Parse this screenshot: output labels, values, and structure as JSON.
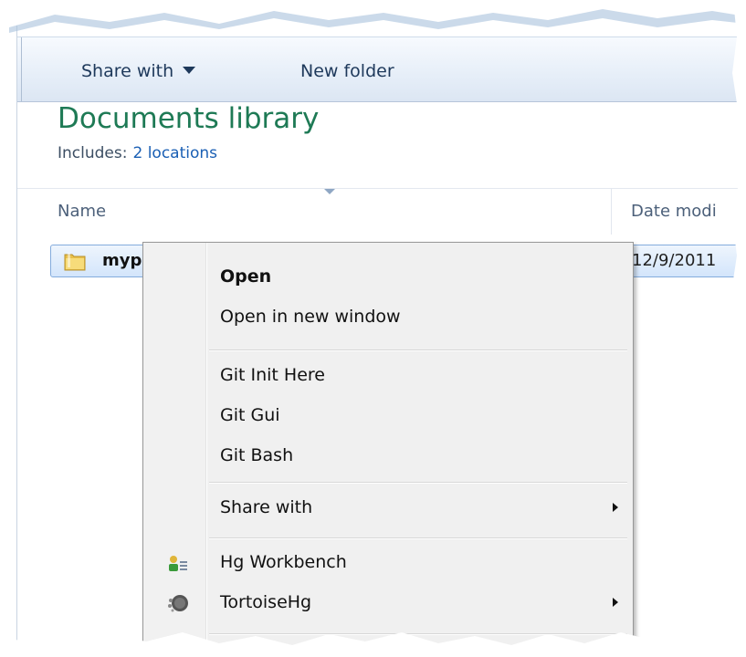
{
  "toolbar": {
    "share_with_label": "Share with",
    "new_folder_label": "New folder"
  },
  "library": {
    "title": "Documents library",
    "includes_label": "Includes:",
    "includes_link": "2 locations"
  },
  "columns": {
    "name": "Name",
    "date_modified": "Date modi"
  },
  "file": {
    "name": "myprojec",
    "date": "12/9/2011"
  },
  "context_menu": {
    "items": [
      {
        "label": "Open"
      },
      {
        "label": "Open in new window"
      },
      {
        "label": "Git Init Here"
      },
      {
        "label": "Git Gui"
      },
      {
        "label": "Git Bash"
      },
      {
        "label": "Share with"
      },
      {
        "label": "Hg Workbench"
      },
      {
        "label": "TortoiseHg"
      }
    ]
  },
  "colors": {
    "library_title": "#1e7a55",
    "link": "#1a5fb4",
    "selection_border": "#84acdd",
    "menu_background": "#f0f0f0"
  },
  "icons": {
    "folder": "folder-icon",
    "hg_workbench": "hg-workbench-icon",
    "tortoisehg": "tortoisehg-icon",
    "submenu": "chevron-right-icon",
    "dropdown": "chevron-down-icon"
  }
}
